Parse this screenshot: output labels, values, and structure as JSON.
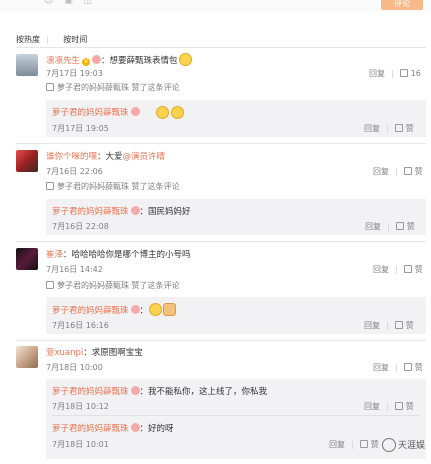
{
  "topbar": {
    "button_label": "评论"
  },
  "sort": {
    "by_hot": "按热度",
    "sep": "|",
    "by_time": "按时间"
  },
  "actions": {
    "reply": "回复",
    "like": "赞",
    "sep": "|"
  },
  "comments": [
    {
      "user": "凛凛先生",
      "text": "：想要薛甄珠表情包",
      "time": "7月17日 19:03",
      "likes": "16",
      "liked_by": "萝子君的妈妈薛甄珠 赞了这条评论",
      "replies": [
        {
          "user": "萝子君的妈妈薛甄珠",
          "text": "",
          "time": "7月17日 19:05"
        }
      ]
    },
    {
      "user": "谁你个咪的嘿",
      "text": "：大爱",
      "tag": "@演员许晴",
      "time": "7月16日 22:06",
      "likes": "",
      "liked_by": "萝子君的妈妈薛甄珠 赞了这条评论",
      "replies": [
        {
          "user": "萝子君的妈妈薛甄珠",
          "text": "：国民妈妈好",
          "time": "7月16日 22:08"
        }
      ]
    },
    {
      "user": "崔泽",
      "text": "：哈哈哈哈你是哪个博主的小号吗",
      "time": "7月16日 14:42",
      "likes": "",
      "liked_by": "萝子君的妈妈薛甄珠 赞了这条评论",
      "replies": [
        {
          "user": "萝子君的妈妈薛甄珠",
          "text": "：",
          "time": "7月16日 16:16"
        }
      ]
    },
    {
      "user": "萱xuanpi",
      "text": "：求原图啊宝宝",
      "time": "7月18日 10:00",
      "likes": "",
      "replies": [
        {
          "user": "萝子君的妈妈薛甄珠",
          "text": "：我不能私你，这上线了，你私我",
          "time": "7月18日 10:12"
        },
        {
          "user": "萝子君的妈妈薛甄珠",
          "text": "：好的呀",
          "time": "7月18日 10:01"
        }
      ]
    }
  ],
  "watermark": "天涯娱"
}
